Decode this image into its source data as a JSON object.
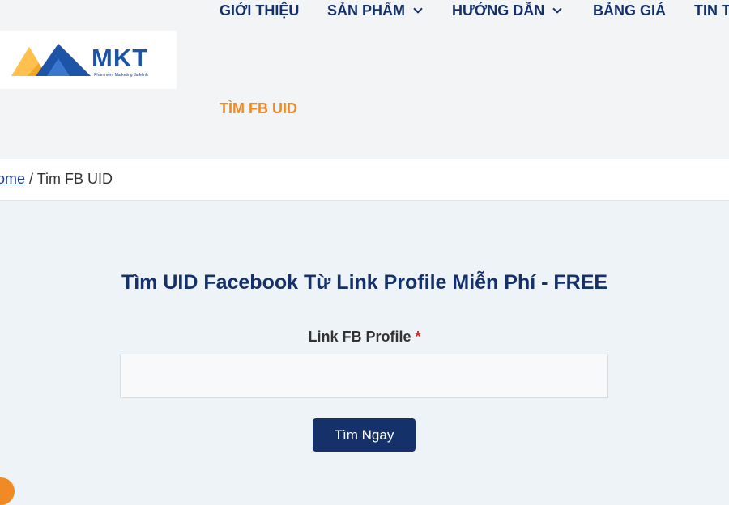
{
  "header": {
    "logo": {
      "text": "MKT",
      "tagline": "Phần mềm Marketing đa kênh"
    },
    "nav": [
      {
        "label": "GIỚI THIỆU"
      },
      {
        "label": "SẢN PHẨM"
      },
      {
        "label": "HƯỚNG DẪN"
      },
      {
        "label": "BẢNG GIÁ"
      },
      {
        "label": "TIN T"
      }
    ],
    "active_item": "TÌM FB UID"
  },
  "breadcrumb": {
    "home": "ome",
    "separator": "/",
    "current": "Tim FB UID"
  },
  "form": {
    "title": "Tìm UID Facebook Từ Link Profile Miễn Phí - FREE",
    "field_label": "Link FB Profile",
    "required_mark": "*",
    "input_value": "",
    "submit_label": "Tìm Ngay"
  },
  "colors": {
    "navy": "#14316a",
    "orange": "#f08a24",
    "logo_blue": "#1c55a8"
  },
  "icons": {
    "dropdown": "chevron-down-icon",
    "logo_mark": "mountain-logo-icon"
  }
}
